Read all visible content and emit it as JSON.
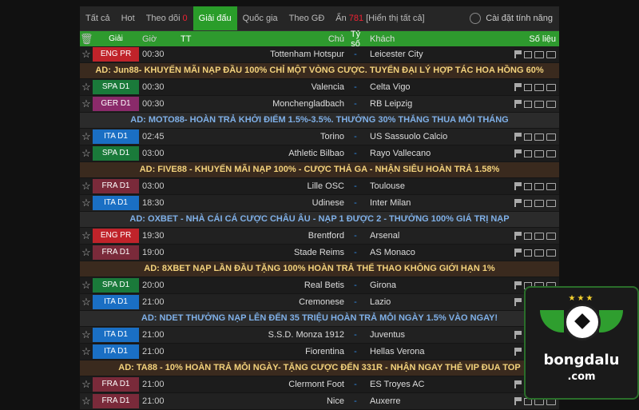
{
  "tabs": [
    {
      "label": "Tất cả",
      "active": false
    },
    {
      "label": "Hot",
      "active": false
    },
    {
      "label": "Theo dõi",
      "count": "0",
      "active": false
    },
    {
      "label": "Giải đấu",
      "active": true
    },
    {
      "label": "Quốc gia",
      "active": false
    },
    {
      "label": "Theo GĐ",
      "active": false
    },
    {
      "label": "Ẩn",
      "count": "781",
      "extra": "[Hiển thị tất cả]",
      "active": false
    }
  ],
  "settings_label": "Cài đặt tính năng",
  "columns": {
    "league": "Giải",
    "time": "Giờ",
    "tt": "TT",
    "home": "Chủ",
    "score": "Tỷ số",
    "away": "Khách",
    "stats": "Số liệu"
  },
  "rows": [
    {
      "type": "match",
      "league": "ENG PR",
      "league_color": "#c0232a",
      "time": "00:30",
      "home": "Tottenham Hotspur",
      "score": "-",
      "away": "Leicester City"
    },
    {
      "type": "ad",
      "text": "AD: Jun88- KHUYẾN MÃI NẠP ĐẦU 100% CHỈ MỘT VÒNG CƯỢC. TUYỂN ĐẠI LÝ HỢP TÁC HOA HỒNG 60%",
      "style": "gold"
    },
    {
      "type": "match",
      "league": "SPA D1",
      "league_color": "#1a7a3a",
      "time": "00:30",
      "home": "Valencia",
      "score": "-",
      "away": "Celta Vigo"
    },
    {
      "type": "match",
      "league": "GER D1",
      "league_color": "#8a2a6a",
      "time": "00:30",
      "home": "Monchengladbach",
      "score": "-",
      "away": "RB Leipzig"
    },
    {
      "type": "ad",
      "text": "AD: MOTO88- HOÀN TRẢ KHỞI ĐIỂM 1.5%-3.5%. THƯỞNG 30% THẮNG THUA MỖI THÁNG",
      "style": "blue"
    },
    {
      "type": "match",
      "league": "ITA D1",
      "league_color": "#1a6fc4",
      "time": "02:45",
      "home": "Torino",
      "score": "-",
      "away": "US Sassuolo Calcio"
    },
    {
      "type": "match",
      "league": "SPA D1",
      "league_color": "#1a7a3a",
      "time": "03:00",
      "home": "Athletic Bilbao",
      "score": "-",
      "away": "Rayo Vallecano"
    },
    {
      "type": "ad",
      "text": "AD: FIVE88 - KHUYẾN MÃI NẠP 100% - CƯỢC THẢ GA - NHẬN SIÊU HOÀN TRẢ 1.58%",
      "style": "gold"
    },
    {
      "type": "match",
      "league": "FRA D1",
      "league_color": "#7a2a3a",
      "time": "03:00",
      "home": "Lille OSC",
      "score": "-",
      "away": "Toulouse"
    },
    {
      "type": "match",
      "league": "ITA D1",
      "league_color": "#1a6fc4",
      "time": "18:30",
      "home": "Udinese",
      "score": "-",
      "away": "Inter Milan"
    },
    {
      "type": "ad",
      "text": "AD: OXBET - NHÀ CÁI CÁ CƯỢC CHÂU ÂU - NẠP 1 ĐƯỢC 2 - THƯỞNG 100% GIÁ TRỊ NẠP",
      "style": "blue"
    },
    {
      "type": "match",
      "league": "ENG PR",
      "league_color": "#c0232a",
      "time": "19:30",
      "home": "Brentford",
      "score": "-",
      "away": "Arsenal"
    },
    {
      "type": "match",
      "league": "FRA D1",
      "league_color": "#7a2a3a",
      "time": "19:00",
      "home": "Stade Reims",
      "score": "-",
      "away": "AS Monaco"
    },
    {
      "type": "ad",
      "text": "AD: 8XBET NẠP LẦN ĐẦU TẶNG 100% HOÀN TRẢ THỂ THAO KHÔNG GIỚI HẠN 1%",
      "style": "gold"
    },
    {
      "type": "match",
      "league": "SPA D1",
      "league_color": "#1a7a3a",
      "time": "20:00",
      "home": "Real Betis",
      "score": "-",
      "away": "Girona"
    },
    {
      "type": "match",
      "league": "ITA D1",
      "league_color": "#1a6fc4",
      "time": "21:00",
      "home": "Cremonese",
      "score": "-",
      "away": "Lazio"
    },
    {
      "type": "ad",
      "text": "AD: NDET   THƯỞNG NẠP LÊN ĐẾN 35 TRIỆU   HOÀN TRẢ MỖI NGÀY 1.5%   VÀO NGAY!",
      "style": "blue"
    },
    {
      "type": "match",
      "league": "ITA D1",
      "league_color": "#1a6fc4",
      "time": "21:00",
      "home": "S.S.D. Monza 1912",
      "score": "-",
      "away": "Juventus"
    },
    {
      "type": "match",
      "league": "ITA D1",
      "league_color": "#1a6fc4",
      "time": "21:00",
      "home": "Fiorentina",
      "score": "-",
      "away": "Hellas Verona"
    },
    {
      "type": "ad",
      "text": "AD: TA88 - 10% HOÀN TRẢ MỖI NGÀY- TẶNG CƯỢC ĐẾN 331R - NHẬN NGAY THẺ VIP ĐUA TOP",
      "style": "gold"
    },
    {
      "type": "match",
      "league": "FRA D1",
      "league_color": "#7a2a3a",
      "time": "21:00",
      "home": "Clermont Foot",
      "score": "-",
      "away": "ES Troyes AC"
    },
    {
      "type": "match",
      "league": "FRA D1",
      "league_color": "#7a2a3a",
      "time": "21:00",
      "home": "Nice",
      "score": "-",
      "away": "Auxerre"
    }
  ],
  "logo": {
    "brand": "bongdalu",
    "domain": ".com"
  }
}
